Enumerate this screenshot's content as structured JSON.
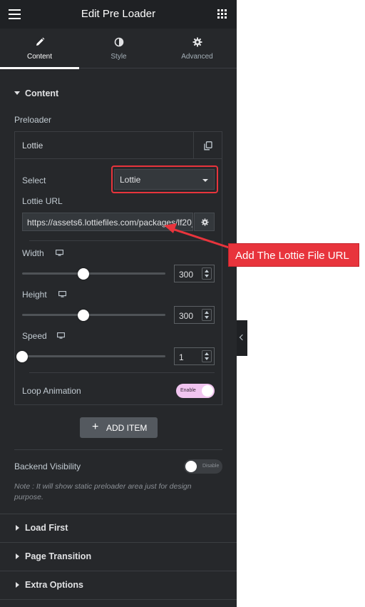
{
  "header": {
    "title": "Edit Pre Loader",
    "menu_icon": "hamburger-icon",
    "apps_icon": "grid-icon"
  },
  "tabs": [
    {
      "label": "Content",
      "icon": "pencil-icon",
      "active": true
    },
    {
      "label": "Style",
      "icon": "half-circle-icon",
      "active": false
    },
    {
      "label": "Advanced",
      "icon": "gear-icon",
      "active": false
    }
  ],
  "content_section": {
    "title": "Content",
    "preloader_label": "Preloader",
    "item": {
      "title": "Lottie",
      "select_label": "Select",
      "select_value": "Lottie",
      "lottie_url_label": "Lottie URL",
      "lottie_url_value": "https://assets6.lottiefiles.com/packages/lf20_",
      "width": {
        "label": "Width",
        "value": "300",
        "level": 0.43
      },
      "height": {
        "label": "Height",
        "value": "300",
        "level": 0.43
      },
      "speed": {
        "label": "Speed",
        "value": "1",
        "level": 0.0
      },
      "loop_animation": {
        "label": "Loop Animation",
        "state": "Enable"
      }
    },
    "add_item_label": "ADD ITEM",
    "backend_visibility": {
      "label": "Backend Visibility",
      "state": "Disable"
    },
    "note": "Note : It will show static preloader area just for design purpose."
  },
  "sections": [
    {
      "title": "Load First"
    },
    {
      "title": "Page Transition"
    },
    {
      "title": "Extra Options"
    }
  ],
  "annotation": {
    "text": "Add The Lottie File URL",
    "color": "#e8343c"
  },
  "colors": {
    "panel_bg": "#26282b",
    "header_bg": "#1f2124",
    "toggle_on": "#f1c5f0"
  }
}
